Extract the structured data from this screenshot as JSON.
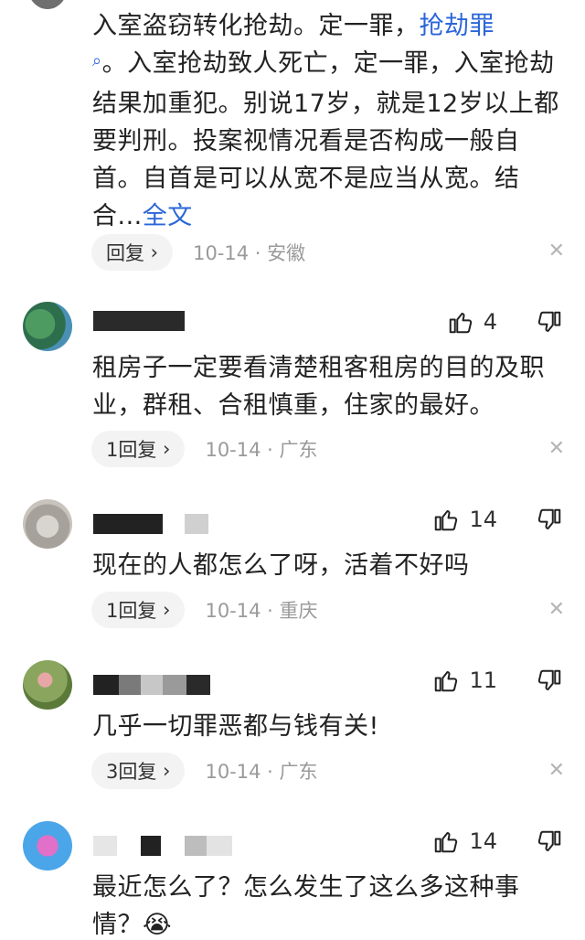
{
  "comments": [
    {
      "text_pre": "入室盗窃转化抢劫。定一罪，",
      "link": "抢劫罪",
      "text_post": "。入室抢劫致人死亡，定一罪，入室抢劫结果加重犯。别说17岁，就是12岁以上都要判刑。投案视情况看是否构成一般自首。自首是可以从宽不是应当从宽。结合...",
      "more": "全文",
      "reply_label": "回复",
      "meta": "10-14 · 安徽"
    },
    {
      "likes": "4",
      "text": "租房子一定要看清楚租客租房的目的及职业，群租、合租慎重，住家的最好。",
      "reply_label": "1回复",
      "meta": "10-14 · 广东"
    },
    {
      "likes": "14",
      "text": "现在的人都怎么了呀，活着不好吗",
      "reply_label": "1回复",
      "meta": "10-14 · 重庆"
    },
    {
      "likes": "11",
      "text": "几乎一切罪恶都与钱有关!",
      "reply_label": "3回复",
      "meta": "10-14 · 广东"
    },
    {
      "likes": "14",
      "text": "最近怎么了？怎么发生了这么多这种事情？",
      "emoji": "😭"
    }
  ],
  "icons": {
    "like": "thumbs-up-icon",
    "dislike": "thumbs-down-icon",
    "close": "close-icon",
    "search": "search-icon"
  },
  "colors": {
    "link": "#2b66d8",
    "meta": "#9a9a9a",
    "reply_bg": "#f3f3f3"
  }
}
